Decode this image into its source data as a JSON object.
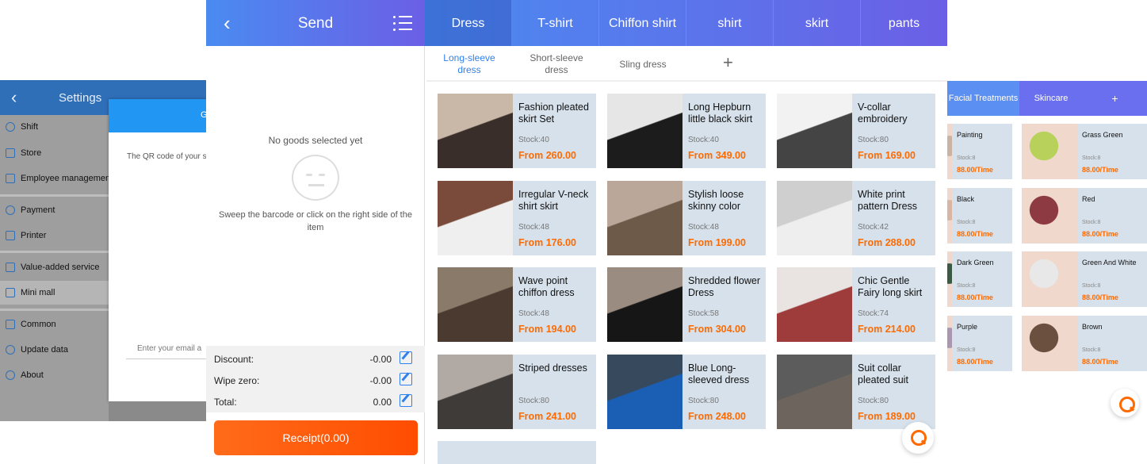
{
  "settings": {
    "title": "Settings",
    "items": [
      {
        "label": "Shift",
        "icon": "person-icon"
      },
      {
        "label": "Store",
        "icon": "store-icon"
      },
      {
        "label": "Employee management",
        "icon": "employee-icon"
      },
      {
        "label": "Payment",
        "icon": "payment-icon"
      },
      {
        "label": "Printer",
        "icon": "printer-icon"
      },
      {
        "label": "Value-added service",
        "icon": "value-added-icon"
      },
      {
        "label": "Mini mall",
        "icon": "mini-mall-icon"
      },
      {
        "label": "Common",
        "icon": "common-icon"
      },
      {
        "label": "Update data",
        "icon": "update-icon"
      },
      {
        "label": "About",
        "icon": "info-icon"
      }
    ],
    "dialog": {
      "header_fragment": "G",
      "qr_text": "The QR code of your s",
      "email_placeholder": "Enter your email a"
    }
  },
  "send": {
    "title": "Send",
    "empty_title": "No goods selected yet",
    "empty_hint": "Sweep the barcode or click on the right side of the item",
    "discount_label": "Discount:",
    "discount_value": "-0.00",
    "wipe_label": "Wipe zero:",
    "wipe_value": "-0.00",
    "total_label": "Total:",
    "total_value": "0.00",
    "receipt_label": "Receipt(0.00)"
  },
  "catalog": {
    "tabs": [
      "Dress",
      "T-shirt",
      "Chiffon shirt",
      "shirt",
      "skirt",
      "pants"
    ],
    "active_tab": "Dress",
    "subtabs": [
      "Long-sleeve dress",
      "Short-sleeve dress",
      "Sling dress"
    ],
    "add_symbol": "+",
    "products": [
      {
        "name": "Fashion pleated skirt Set",
        "stock": "Stock:40",
        "price": "From 260.00"
      },
      {
        "name": "Long Hepburn little black skirt",
        "stock": "Stock:40",
        "price": "From 349.00"
      },
      {
        "name": "V-collar embroidery",
        "stock": "Stock:80",
        "price": "From 169.00"
      },
      {
        "name": "Irregular V-neck shirt skirt",
        "stock": "Stock:48",
        "price": "From 176.00"
      },
      {
        "name": "Stylish loose skinny color",
        "stock": "Stock:48",
        "price": "From 199.00"
      },
      {
        "name": "White print pattern Dress",
        "stock": "Stock:42",
        "price": "From 288.00"
      },
      {
        "name": "Wave point chiffon dress",
        "stock": "Stock:48",
        "price": "From 194.00"
      },
      {
        "name": "Shredded flower Dress",
        "stock": "Stock:58",
        "price": "From 304.00"
      },
      {
        "name": "Chic Gentle Fairy long skirt",
        "stock": "Stock:74",
        "price": "From 214.00"
      },
      {
        "name": "Striped dresses",
        "stock": "Stock:80",
        "price": "From 241.00"
      },
      {
        "name": "Blue Long-sleeved dress",
        "stock": "Stock:80",
        "price": "From 248.00"
      },
      {
        "name": "Suit collar pleated suit",
        "stock": "Stock:80",
        "price": "From 189.00"
      }
    ]
  },
  "beauty": {
    "tabs": [
      "Facial Treatments",
      "Skincare",
      "+"
    ],
    "items": [
      {
        "name": "Painting",
        "stock": "Stock:8",
        "price": "88.00/Time"
      },
      {
        "name": "Grass Green",
        "stock": "Stock:8",
        "price": "88.00/Time"
      },
      {
        "name": "Black",
        "stock": "Stock:8",
        "price": "88.00/Time"
      },
      {
        "name": "Red",
        "stock": "Stock:8",
        "price": "88.00/Time"
      },
      {
        "name": "Dark Green",
        "stock": "Stock:8",
        "price": "88.00/Time"
      },
      {
        "name": "Green And White",
        "stock": "Stock:8",
        "price": "88.00/Time"
      },
      {
        "name": "Purple",
        "stock": "Stock:8",
        "price": "88.00/Time"
      },
      {
        "name": "Brown",
        "stock": "Stock:8",
        "price": "88.00/Time"
      }
    ]
  },
  "colors": {
    "accent_blue": "#4a8bf0",
    "accent_purple": "#6b5fe6",
    "price_orange": "#ff6a00",
    "receipt_orange": "#ff5a0a"
  }
}
